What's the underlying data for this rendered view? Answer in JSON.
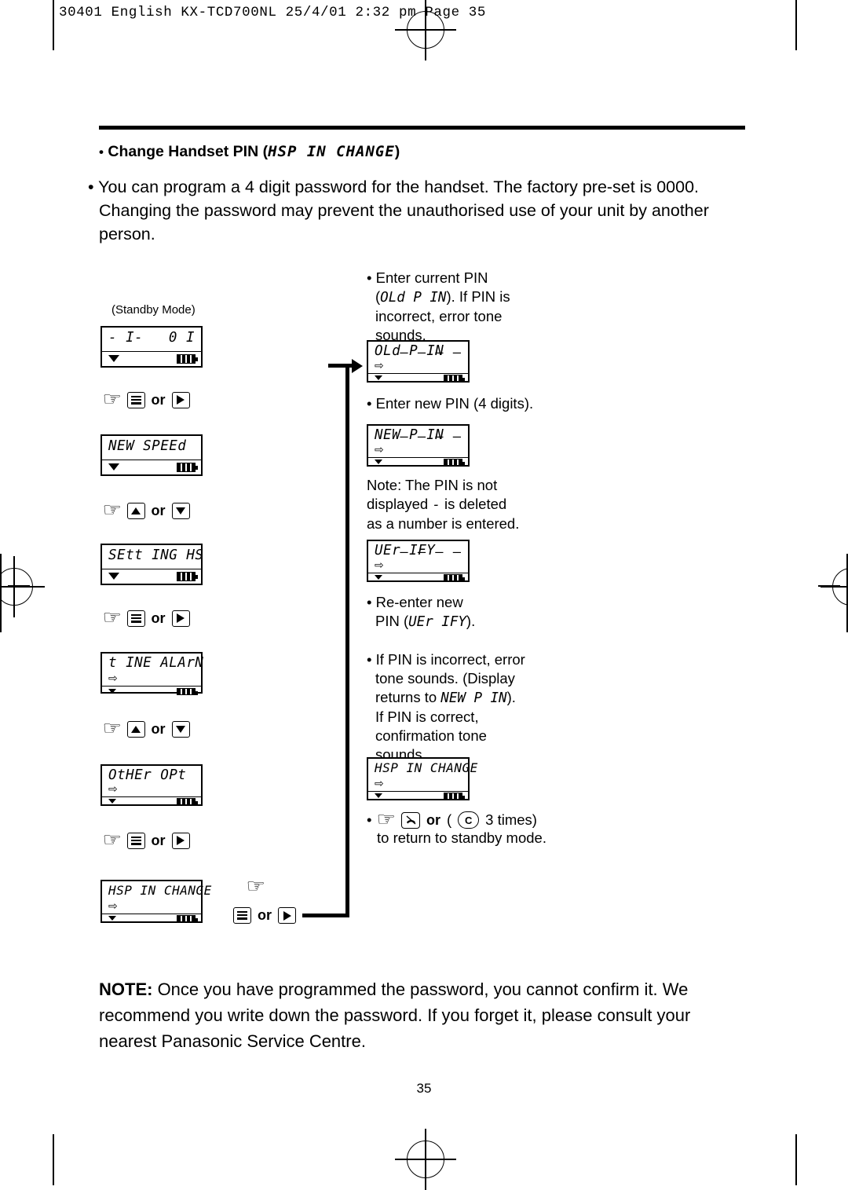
{
  "slug": "30401 English KX-TCD700NL  25/4/01  2:32 pm  Page 35",
  "page_number": "35",
  "heading": {
    "bullet": "•",
    "text": "Change Handset PIN (",
    "lcd": "HSP IN  CHANGE",
    "close": ")"
  },
  "intro": {
    "bullet": "•",
    "paragraph": "You can program a 4 digit password for the handset. The factory pre-set is 0000. Changing the password may prevent the unauthorised use of your unit by another person."
  },
  "left_column": {
    "standby_label": "(Standby Mode)",
    "screens": [
      {
        "name": "standby",
        "line": "- I-",
        "right": "0 I"
      },
      {
        "name": "new-speed",
        "line": "NEW SPEEd"
      },
      {
        "name": "settings",
        "line": "SEtt ING HS"
      },
      {
        "name": "time-alarm",
        "line": "t INE ALArN"
      },
      {
        "name": "other-opt",
        "line": "OtHEr OPt"
      },
      {
        "name": "hsp-in-change",
        "line": "HSP IN CHANGE"
      }
    ],
    "steps": [
      {
        "keys": "menu-or-right",
        "or": "or"
      },
      {
        "keys": "up-or-down",
        "or": "or"
      },
      {
        "keys": "menu-or-right",
        "or": "or"
      },
      {
        "keys": "up-or-down",
        "or": "or"
      },
      {
        "keys": "menu-or-right",
        "or": "or"
      }
    ],
    "final_step": {
      "or": "or"
    }
  },
  "right_column": {
    "step1": {
      "bullet": "•",
      "line1": "Enter current PIN",
      "line2_pre": "(",
      "line2_lcd": "OLd P IN",
      "line2_post": "). If PIN is",
      "line3": "incorrect, error tone",
      "line4": "sounds."
    },
    "screen_old_pin": {
      "line": "OLd  P IN",
      "dashes": "– – – –"
    },
    "step2": {
      "bullet": "•",
      "text": "Enter new PIN (4 digits)."
    },
    "screen_new_pin": {
      "line": "NEW  P IN",
      "dashes": "– – – –"
    },
    "note_pin": {
      "line1": "Note: The PIN is not",
      "line2_pre": "displayed ",
      "line2_lcd": "-",
      "line2_post": " is deleted",
      "line3": "as a number is entered."
    },
    "screen_verify": {
      "line": "UEr IFY",
      "dashes": "– – – –"
    },
    "step3": {
      "bullet": "•",
      "line1": "Re-enter new",
      "line2_pre": "PIN (",
      "line2_lcd": "UEr IFY",
      "line2_post": ")."
    },
    "step4": {
      "bullet": "•",
      "line1": "If PIN is incorrect, error",
      "line2": "tone sounds. (Display",
      "line3_pre": "returns to ",
      "line3_lcd": "NEW P IN",
      "line3_post": ").",
      "line4": "If PIN is correct,",
      "line5": "confirmation tone",
      "line6": "sounds."
    },
    "screen_hsp_change": {
      "line": "HSP IN CHANGE"
    },
    "step5": {
      "bullet": "•",
      "or": "or",
      "c_key": "C",
      "times": "3 times)",
      "paren_open": "(",
      "line2": "to return to standby mode."
    }
  },
  "footer_note": {
    "label": "NOTE:",
    "text": " Once you have programmed the password, you cannot confirm it. We recommend you write down the password. If you forget it, please consult your nearest Panasonic Service Centre."
  }
}
